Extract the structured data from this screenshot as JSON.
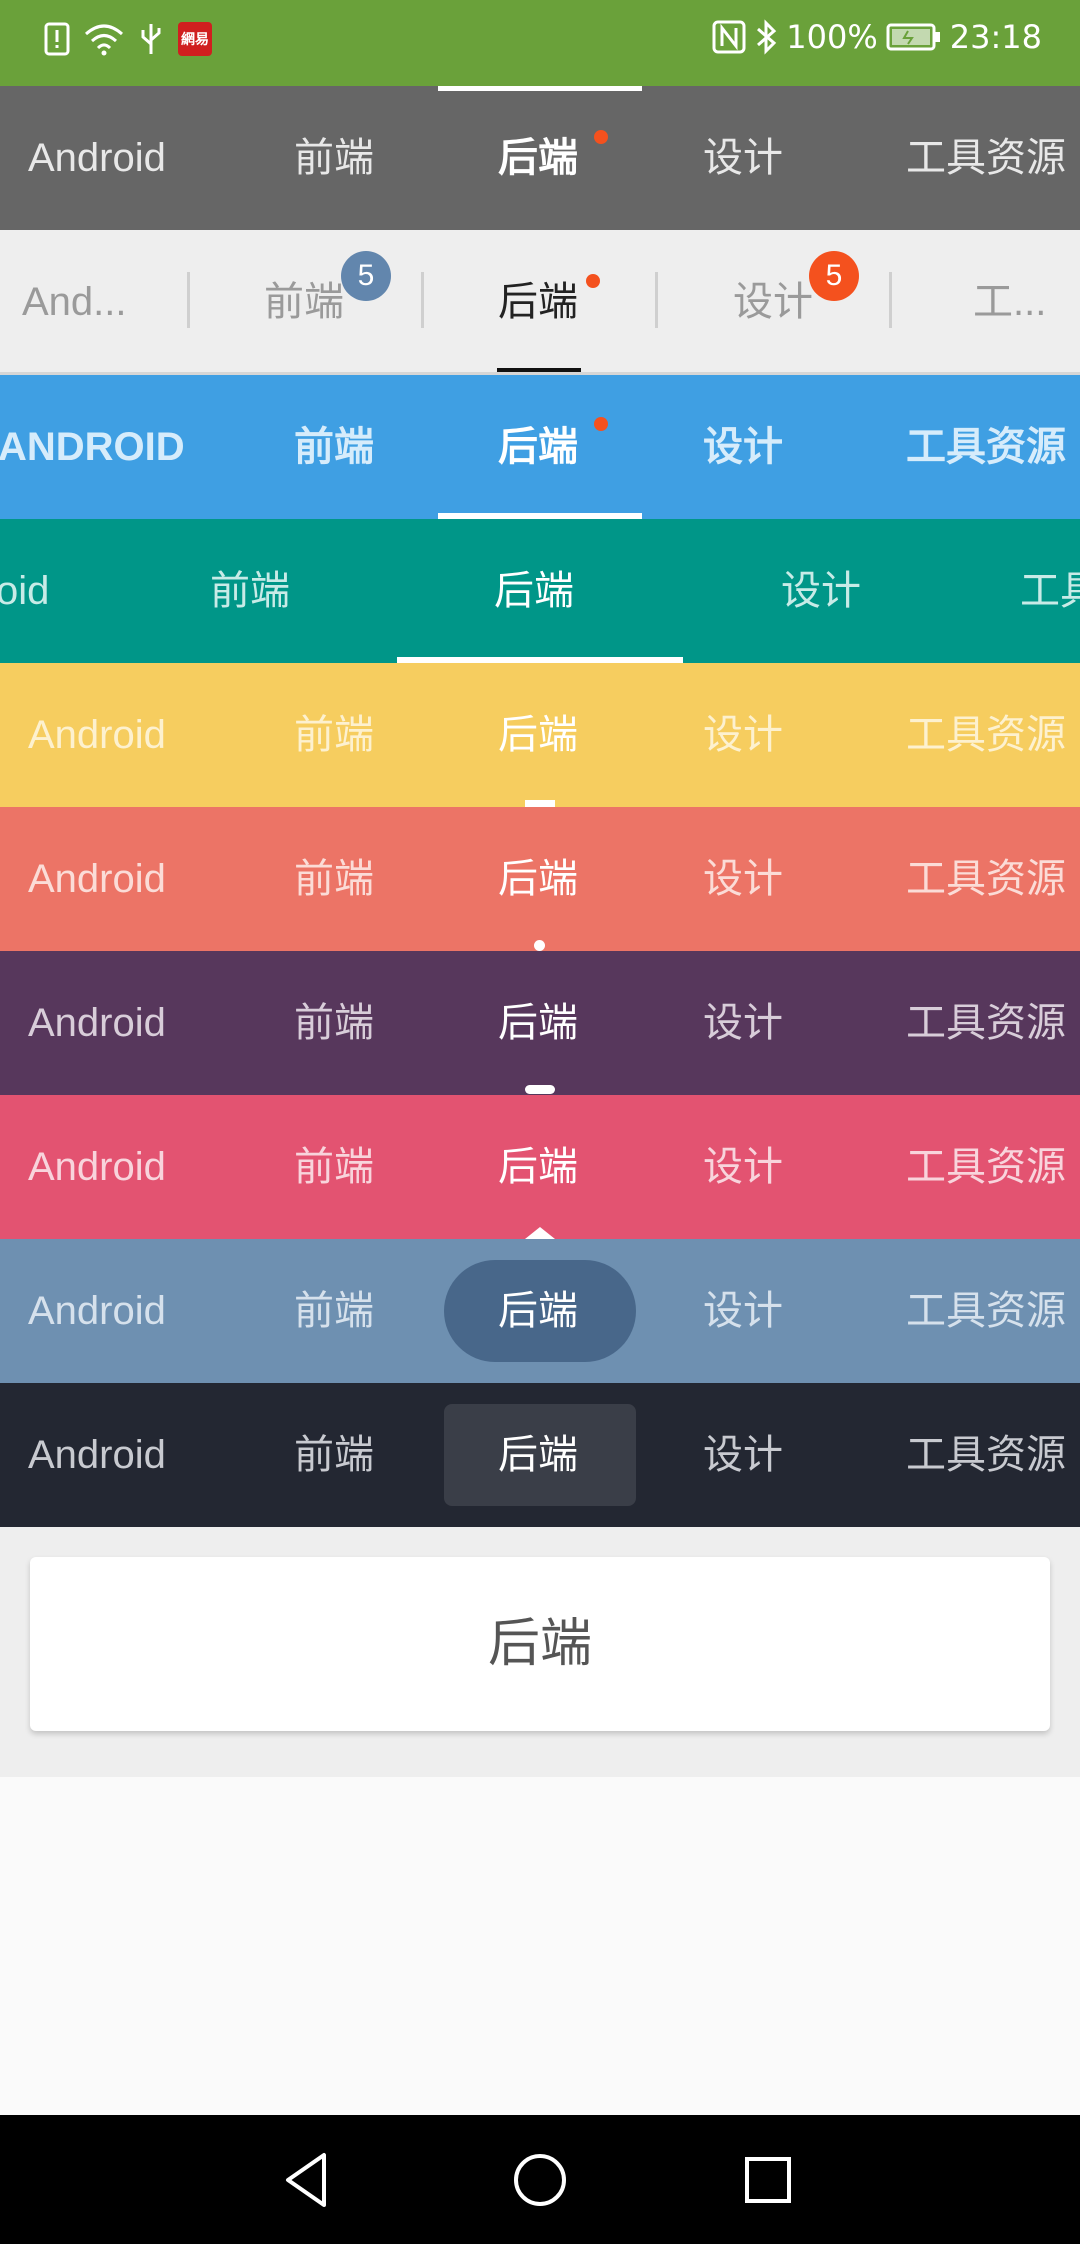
{
  "status_bar": {
    "icons_left": [
      "alert-icon",
      "wifi-icon",
      "usb-icon",
      "app-icon"
    ],
    "app_icon_text": "網易",
    "icons_right": [
      "nfc-icon",
      "bluetooth-icon",
      "battery-icon"
    ],
    "battery": "100%",
    "time": "23:18"
  },
  "tabs": [
    "Android",
    "前端",
    "后端",
    "设计",
    "工具资源"
  ],
  "row2_tabs": [
    "And...",
    "前端",
    "后端",
    "设计",
    "工..."
  ],
  "row3_tabs": [
    "ANDROID",
    "前端",
    "后端",
    "设计",
    "工具资源"
  ],
  "row4_tabs": [
    "oid",
    "前端",
    "后端",
    "设计",
    "工具"
  ],
  "badges": {
    "frontend_count": "5",
    "design_count": "5"
  },
  "selected_card": {
    "label": "后端"
  },
  "colors": {
    "status_bar": "#6aa13a",
    "row1": "#666666",
    "row2": "#eeeeee",
    "row3": "#3f9fe3",
    "row4": "#009688",
    "row5": "#f6cd5f",
    "row6": "#ec7466",
    "row7": "#57375c",
    "row8": "#e35371",
    "row9": "#6e90b1",
    "row10": "#232732",
    "badge_red": "#f4511e",
    "badge_blue": "#6286ad"
  },
  "nav": {
    "buttons": [
      "back-icon",
      "home-icon",
      "recents-icon"
    ]
  }
}
